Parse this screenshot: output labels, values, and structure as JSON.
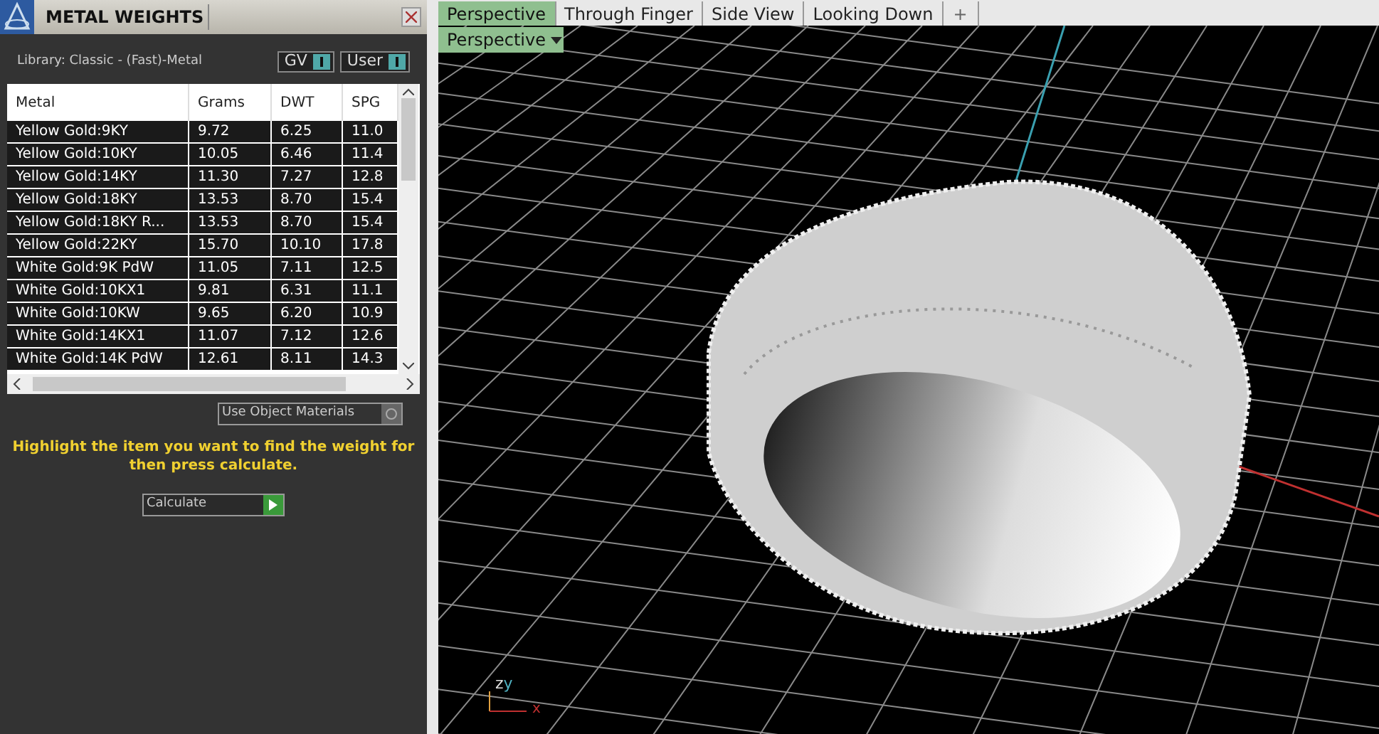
{
  "panel": {
    "title": "METAL WEIGHTS",
    "library": "Library: Classic - (Fast)-Metal",
    "toggles": [
      {
        "label": "GV",
        "on": true
      },
      {
        "label": "User",
        "on": true
      }
    ],
    "table": {
      "columns": [
        "Metal",
        "Grams",
        "DWT",
        "SPG"
      ],
      "rows": [
        [
          "Yellow Gold:9KY",
          "9.72",
          "6.25",
          "11.0"
        ],
        [
          "Yellow Gold:10KY",
          "10.05",
          "6.46",
          "11.4"
        ],
        [
          "Yellow Gold:14KY",
          "11.30",
          "7.27",
          "12.8"
        ],
        [
          "Yellow Gold:18KY",
          "13.53",
          "8.70",
          "15.4"
        ],
        [
          "Yellow Gold:18KY R...",
          "13.53",
          "8.70",
          "15.4"
        ],
        [
          "Yellow Gold:22KY",
          "15.70",
          "10.10",
          "17.8"
        ],
        [
          "White Gold:9K PdW",
          "11.05",
          "7.11",
          "12.5"
        ],
        [
          "White Gold:10KX1",
          "9.81",
          "6.31",
          "11.1"
        ],
        [
          "White Gold:10KW",
          "9.65",
          "6.20",
          "10.9"
        ],
        [
          "White Gold:14KX1",
          "11.07",
          "7.12",
          "12.6"
        ],
        [
          "White Gold:14K PdW",
          "12.61",
          "8.11",
          "14.3"
        ]
      ]
    },
    "use_object_materials": {
      "label": "Use Object Materials",
      "on": false
    },
    "hint": "Highlight the item you want to find the weight for then press calculate.",
    "calculate": "Calculate"
  },
  "viewport": {
    "tabs": [
      {
        "label": "Perspective",
        "selected": true
      },
      {
        "label": "Through Finger",
        "selected": false
      },
      {
        "label": "Side View",
        "selected": false
      },
      {
        "label": "Looking Down",
        "selected": false
      }
    ],
    "add_tab": "+",
    "view_menu": "Perspective",
    "axes": {
      "z": "z",
      "y": "y",
      "x": "x"
    }
  }
}
